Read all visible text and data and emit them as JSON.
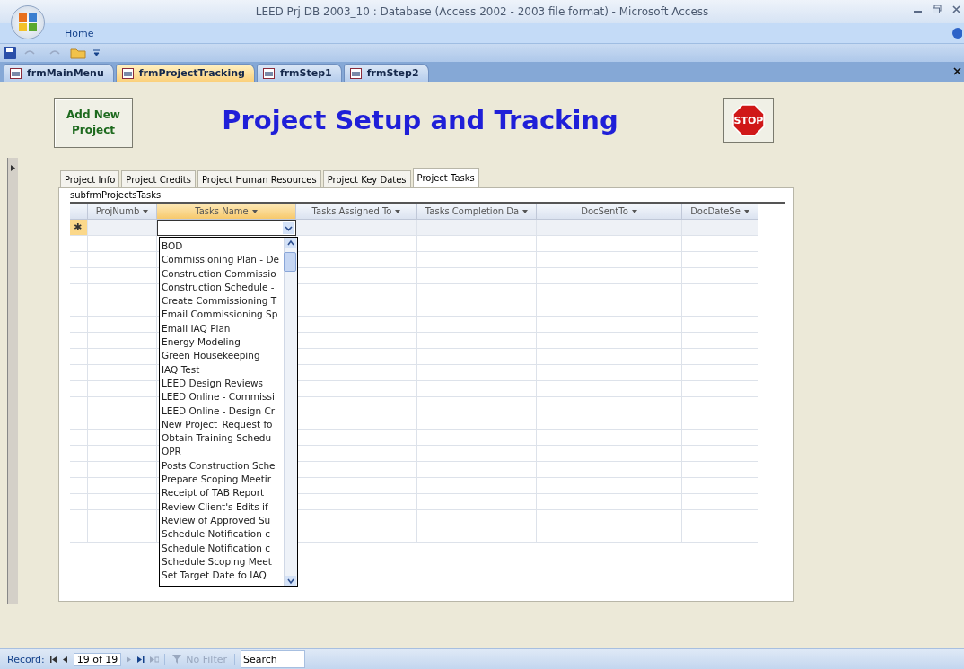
{
  "window": {
    "title": "LEED Prj DB 2003_10 : Database (Access 2002 - 2003 file format) - Microsoft Access"
  },
  "ribbon_tabs": [
    "Home"
  ],
  "document_tabs": [
    {
      "label": "frmMainMenu",
      "selected": false
    },
    {
      "label": "frmProjectTracking",
      "selected": true
    },
    {
      "label": "frmStep1",
      "selected": false
    },
    {
      "label": "frmStep2",
      "selected": false
    }
  ],
  "form": {
    "add_button": "Add New Project",
    "title": "Project Setup and Tracking",
    "stop_label": "STOP",
    "tabs": [
      {
        "label": "Project Info",
        "selected": false
      },
      {
        "label": "Project Credits",
        "selected": false
      },
      {
        "label": "Project Human Resources",
        "selected": false
      },
      {
        "label": "Project Key Dates",
        "selected": false
      },
      {
        "label": "Project Tasks",
        "selected": true
      }
    ],
    "subform_label": "subfrmProjectsTasks",
    "columns": [
      {
        "label": "ProjNumb",
        "selected": false
      },
      {
        "label": "Tasks Name",
        "selected": true
      },
      {
        "label": "Tasks Assigned To",
        "selected": false
      },
      {
        "label": "Tasks Completion Da",
        "selected": false
      },
      {
        "label": "DocSentTo",
        "selected": false
      },
      {
        "label": "DocDateSe",
        "selected": false
      }
    ],
    "new_row_marker": "✱",
    "dropdown_items": [
      "BOD",
      "Commissioning Plan - De",
      "Construction Commissio",
      "Construction Schedule -",
      "Create Commissioning T",
      "Email Commissioning Sp",
      "Email IAQ Plan",
      "Energy Modeling",
      "Green Housekeeping",
      "IAQ Test",
      "LEED Design Reviews",
      "LEED Online - Commissi",
      "LEED Online - Design Cr",
      "New Project_Request fo",
      "Obtain Training Schedu",
      "OPR",
      "Posts Construction Sche",
      "Prepare Scoping Meetir",
      "Receipt of TAB Report",
      "Review Client's Edits if",
      "Review of Approved Su",
      "Schedule Notification c",
      "Schedule Notification c",
      "Schedule Scoping Meet",
      "Set Target Date fo IAQ"
    ]
  },
  "status_bar": {
    "record_label": "Record:",
    "record_position": "19 of 19",
    "filter": "No Filter",
    "search_placeholder": "Search"
  }
}
